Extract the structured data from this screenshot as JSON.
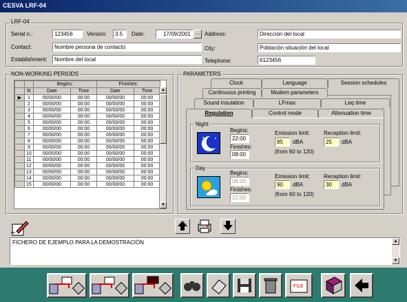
{
  "window": {
    "title": "CESVA LRF-04"
  },
  "header": {
    "group_title": "LRF-04",
    "serial_label": "Serial n.:",
    "serial_value": "123456",
    "version_label": "Version:",
    "version_value": "3.5",
    "date_label": "Date:",
    "date_value": "17/09/2001",
    "contact_label": "Contact:",
    "contact_value": "Nombre persona de contacto",
    "establishment_label": "Establishment:",
    "establishment_value": "Nombre del local",
    "address_label": "Address:",
    "address_value": "Dirección del local",
    "city_label": "City:",
    "city_value": "Población situación del local",
    "telephone_label": "Telephone:",
    "telephone_value": "6123456"
  },
  "nwp": {
    "title": "NON-WORKING PERIODS",
    "begins": "Begins:",
    "finishes": "Finishes:",
    "col_n": "N",
    "col_date": "Date",
    "col_time": "Time",
    "rows": [
      {
        "n": "1",
        "bd": "00/00/00",
        "bt": "00:00",
        "fd": "00/00/00",
        "ft": "00:00"
      },
      {
        "n": "2",
        "bd": "00/00/00",
        "bt": "00:00",
        "fd": "00/00/00",
        "ft": "00:00"
      },
      {
        "n": "3",
        "bd": "00/00/00",
        "bt": "00:00",
        "fd": "00/00/00",
        "ft": "00:00"
      },
      {
        "n": "4",
        "bd": "00/00/00",
        "bt": "00:00",
        "fd": "00/00/00",
        "ft": "00:00"
      },
      {
        "n": "5",
        "bd": "00/00/00",
        "bt": "00:00",
        "fd": "00/00/00",
        "ft": "00:00"
      },
      {
        "n": "6",
        "bd": "00/00/00",
        "bt": "00:00",
        "fd": "00/00/00",
        "ft": "00:00"
      },
      {
        "n": "7",
        "bd": "00/00/00",
        "bt": "00:00",
        "fd": "00/00/00",
        "ft": "00:00"
      },
      {
        "n": "8",
        "bd": "00/00/00",
        "bt": "00:00",
        "fd": "00/00/00",
        "ft": "00:00"
      },
      {
        "n": "9",
        "bd": "00/00/00",
        "bt": "00:00",
        "fd": "00/00/00",
        "ft": "00:00"
      },
      {
        "n": "10",
        "bd": "00/00/00",
        "bt": "00:00",
        "fd": "00/00/00",
        "ft": "00:00"
      },
      {
        "n": "11",
        "bd": "00/00/00",
        "bt": "00:00",
        "fd": "00/00/00",
        "ft": "00:00"
      },
      {
        "n": "12",
        "bd": "00/00/00",
        "bt": "00:00",
        "fd": "00/00/00",
        "ft": "00:00"
      },
      {
        "n": "13",
        "bd": "00/00/00",
        "bt": "00:00",
        "fd": "00/00/00",
        "ft": "00:00"
      },
      {
        "n": "14",
        "bd": "00/00/00",
        "bt": "00:00",
        "fd": "00/00/00",
        "ft": "00:00"
      },
      {
        "n": "15",
        "bd": "00/00/00",
        "bt": "00:00",
        "fd": "00/00/00",
        "ft": "00:00"
      }
    ]
  },
  "params": {
    "title": "PARAMETERS",
    "tabs_row1": [
      "Clock",
      "Language",
      "Session schedules"
    ],
    "tabs_row2": [
      "Continuous printing",
      "Modem parameters",
      "Leq time"
    ],
    "tabs_row3": [
      "Sound insulation",
      "LFmax",
      "Leq time"
    ],
    "tabs_row4": [
      "Regulation",
      "Control mode",
      "Attenuation time"
    ],
    "night": {
      "label": "Night",
      "begins_label": "Begins:",
      "begins": "22:00",
      "finishes_label": "Finishes:",
      "finishes": "08:00",
      "emission_label": "Emission limit:",
      "emission": "85",
      "emission_unit": "dBA",
      "range": "(from 60 to 120)",
      "reception_label": "Reception limit:",
      "reception": "25",
      "reception_unit": "dBA"
    },
    "day": {
      "label": "Day",
      "begins_label": "Begins:",
      "begins": "08:00",
      "finishes_label": "Finishes:",
      "finishes": "22:00",
      "emission_label": "Emission limit:",
      "emission": "90",
      "emission_unit": "dBA",
      "range": "(from 60 to 120)",
      "reception_label": "Reception limit:",
      "reception": "30",
      "reception_unit": "dBA"
    }
  },
  "notes": {
    "text": "FICHERO DE EJEMPLO PARA LA DEMOSTRACIÓN"
  },
  "colors": {
    "bottom_bar": "#2d7a6e",
    "title_bar": "#0a246a",
    "limit_field": "#ffffc0"
  }
}
